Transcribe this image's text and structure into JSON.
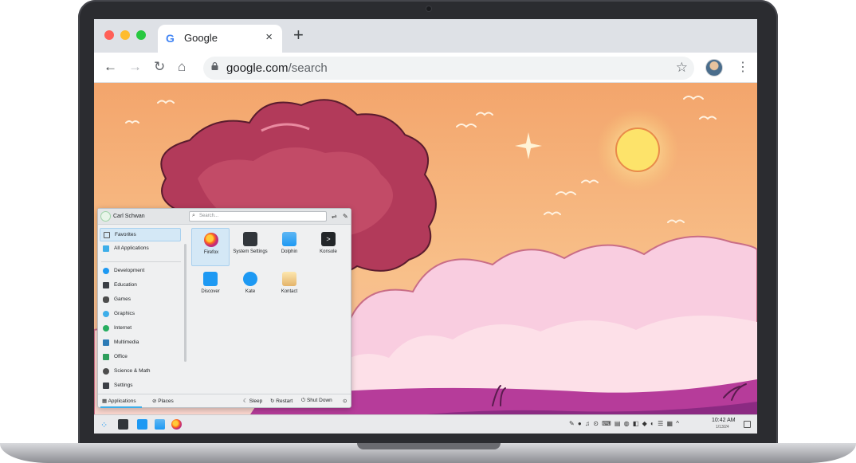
{
  "browser": {
    "tab_title": "Google",
    "tab_favicon": "G",
    "tab_close": "×",
    "new_tab": "+",
    "url_host": "google.com",
    "url_path": "/search",
    "icons": [
      "back-arrow-icon",
      "forward-arrow-icon",
      "reload-icon",
      "home-icon",
      "lock-icon",
      "star-icon",
      "profile-avatar",
      "kebab-menu-icon"
    ]
  },
  "launcher": {
    "user_name": "Carl Schwan",
    "search_placeholder": "Search...",
    "sidebar": [
      {
        "label": "Favorites",
        "icon": "bookmark-icon"
      },
      {
        "label": "All Applications",
        "icon": "grid-icon"
      },
      {
        "label": "Development",
        "icon": "development-icon"
      },
      {
        "label": "Education",
        "icon": "education-icon"
      },
      {
        "label": "Games",
        "icon": "gamepad-icon"
      },
      {
        "label": "Graphics",
        "icon": "graphics-icon"
      },
      {
        "label": "Internet",
        "icon": "globe-icon"
      },
      {
        "label": "Multimedia",
        "icon": "multimedia-icon"
      },
      {
        "label": "Office",
        "icon": "office-icon"
      },
      {
        "label": "Science & Math",
        "icon": "science-icon"
      },
      {
        "label": "Settings",
        "icon": "settings-icon"
      }
    ],
    "apps": [
      {
        "label": "Firefox",
        "icon": "firefox-icon"
      },
      {
        "label": "System Settings",
        "icon": "system-settings-icon"
      },
      {
        "label": "Dolphin",
        "icon": "dolphin-folder-icon"
      },
      {
        "label": "Konsole",
        "icon": "konsole-icon"
      },
      {
        "label": "Discover",
        "icon": "discover-icon"
      },
      {
        "label": "Kate",
        "icon": "kate-icon"
      },
      {
        "label": "Kontact",
        "icon": "kontact-icon"
      }
    ],
    "footer": {
      "applications": "Applications",
      "places": "Places",
      "sleep": "Sleep",
      "restart": "Restart",
      "shutdown": "Shut Down"
    }
  },
  "panel": {
    "time": "10:42 AM",
    "date": "1/13/24",
    "tray_icons": [
      "pen-icon",
      "record-icon",
      "notifications-icon",
      "vault-icon",
      "clipboard-icon",
      "battery-icon",
      "network-icon",
      "volume-icon",
      "bluetooth-icon",
      "wifi-icon",
      "keyboard-icon",
      "expand-icon"
    ]
  },
  "colors": {
    "kde_accent": "#3daee9",
    "sky_top": "#f5b26e",
    "sky_bottom": "#f7c18b",
    "tree": "#b23a5a"
  }
}
